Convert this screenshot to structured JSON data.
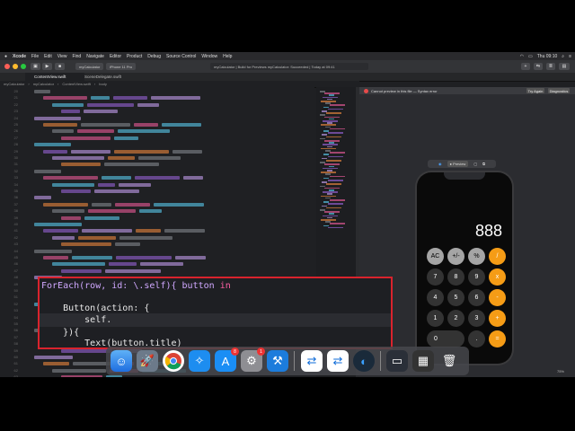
{
  "menubar": {
    "items": [
      "Xcode",
      "File",
      "Edit",
      "View",
      "Find",
      "Navigate",
      "Editor",
      "Product",
      "Debug",
      "Source Control",
      "Window",
      "Help"
    ],
    "clock": "Thu 09:10"
  },
  "toolbar": {
    "scheme": "myCalculator",
    "device": "iPhone 11 Pro",
    "status": "myCalculator | Build for Previews myCalculator: Succeeded | Today at 09:41"
  },
  "tabs": [
    "ContentView.swift",
    "SceneDelegate.swift"
  ],
  "jumpbar": [
    "myCalculator",
    "myCalculator",
    "ContentView.swift",
    "body"
  ],
  "canvas": {
    "message": "Cannot preview in this file — Syntax error",
    "try_again": "Try Again",
    "diagnostics": "Diagnostics",
    "preview_label": "Preview",
    "zoom": "75%"
  },
  "calculator": {
    "display": "888",
    "rows": [
      [
        {
          "t": "AC",
          "k": "fn"
        },
        {
          "t": "+/-",
          "k": "fn"
        },
        {
          "t": "%",
          "k": "fn"
        },
        {
          "t": "/",
          "k": "op"
        }
      ],
      [
        {
          "t": "7",
          "k": "num"
        },
        {
          "t": "8",
          "k": "num"
        },
        {
          "t": "9",
          "k": "num"
        },
        {
          "t": "x",
          "k": "op"
        }
      ],
      [
        {
          "t": "4",
          "k": "num"
        },
        {
          "t": "5",
          "k": "num"
        },
        {
          "t": "6",
          "k": "num"
        },
        {
          "t": "-",
          "k": "op"
        }
      ],
      [
        {
          "t": "1",
          "k": "num"
        },
        {
          "t": "2",
          "k": "num"
        },
        {
          "t": "3",
          "k": "num"
        },
        {
          "t": "+",
          "k": "op"
        }
      ],
      [
        {
          "t": "0",
          "k": "num",
          "zero": true
        },
        {
          "t": ".",
          "k": "num"
        },
        {
          "t": "=",
          "k": "op"
        }
      ]
    ]
  },
  "code": {
    "line1_a": "ForEach(row, id: \\.self){ button ",
    "line1_kw": "in",
    "line2": "    Button(action: {",
    "line3": "        self.",
    "line4": "    }){",
    "line5": "        Text(button.title)"
  },
  "dock": {
    "badge_appstore": "8",
    "badge_settings": "1"
  }
}
